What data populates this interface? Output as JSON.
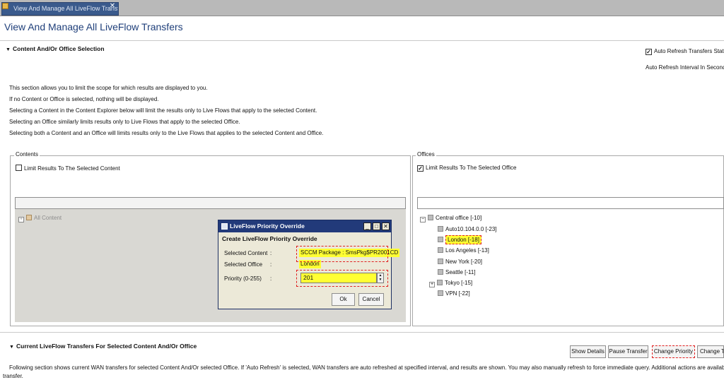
{
  "tab": {
    "title": "View And Manage All LiveFlow Transfers",
    "close": "✕"
  },
  "page": {
    "title": "View And Manage All LiveFlow Transfers"
  },
  "content_section": {
    "header": "Content And/Or Office Selection",
    "auto_refresh_label": "Auto Refresh Transfers State",
    "auto_refresh_interval_label": "Auto Refresh Interval In Seconds",
    "description": [
      "This section allows you to limit the scope for which results are displayed to you.",
      "If no Content or Office is selected, nothing will be displayed.",
      "Selecting a Content in the Content Explorer below will limit the results only to Live Flows that apply to the selected Content.",
      "Selecting an Office similarly limits results only to Live Flows that apply to the selected Office.",
      "Selecting both a Content and an Office will limits results only to the Live Flows that applies to the selected Content and Office."
    ]
  },
  "contents_panel": {
    "legend": "Contents",
    "limit_label": "Limit Results To The Selected Content",
    "tree_root": "All Content"
  },
  "offices_panel": {
    "legend": "Offices",
    "limit_label": "Limit Results To The Selected Office",
    "tree": {
      "root": "Central office [-10]",
      "children": [
        "Auto10.104.0.0 [-23]",
        "London [-18]",
        "Los Angeles [-13]",
        "New York [-20]",
        "Seattle [-11]",
        "Tokyo [-15]",
        "VPN [-22]"
      ]
    }
  },
  "dialog": {
    "title": "LiveFlow Priority Override",
    "heading": "Create LiveFlow Priority Override",
    "selected_content_label": "Selected Content",
    "selected_content_value": "SCCM Package : SmsPkg$PR2001CD",
    "selected_office_label": "Selected Office",
    "selected_office_value": "London",
    "priority_label": "Priority (0-255)",
    "priority_value": "201",
    "colon": ":",
    "ok": "Ok",
    "cancel": "Cancel"
  },
  "transfers_section": {
    "header": "Current LiveFlow Transfers For Selected Content And/Or Office",
    "buttons": {
      "show_details": "Show Details",
      "pause_transfer": "Pause Transfer",
      "change_priority": "Change Priority",
      "change_t": "Change T"
    },
    "description_line1": "Following section shows current WAN transfers for selected Content And/Or selected Office. If 'Auto Refresh' is selected, WAN transfers are auto refreshed at specified interval, and results are shown. You may also manually refresh to force immediate query. Additional actions are available on right cli",
    "description_line2": "transfer."
  },
  "colors": {
    "highlight": "#ffff33",
    "annotation": "#e02020",
    "dialog_title": "#223a7a"
  }
}
